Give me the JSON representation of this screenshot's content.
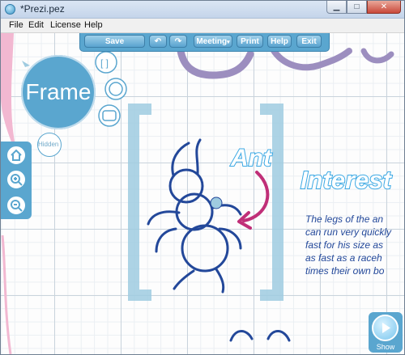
{
  "window": {
    "title": "*Prezi.pez"
  },
  "menu": [
    "File",
    "Edit",
    "License",
    "Help"
  ],
  "toolbar": {
    "save": "Save",
    "meeting": "Meeting",
    "print": "Print",
    "help": "Help",
    "exit": "Exit"
  },
  "zebra": {
    "frame_label": "Frame",
    "hidden_label": "Hidden"
  },
  "show": {
    "label": "Show"
  },
  "canvas": {
    "ant_label": "Ant",
    "heading": "Interest",
    "body_lines": [
      "The legs of the an",
      "can run very quickly",
      "fast for his size as",
      "as fast as a raceh",
      "times their own bo"
    ]
  },
  "colors": {
    "accent": "#5aa6cf",
    "ink_blue": "#23489a",
    "arrow": "#c02f78",
    "purple": "#9c8ebf",
    "frame_bracket": "#9fcbe0"
  }
}
